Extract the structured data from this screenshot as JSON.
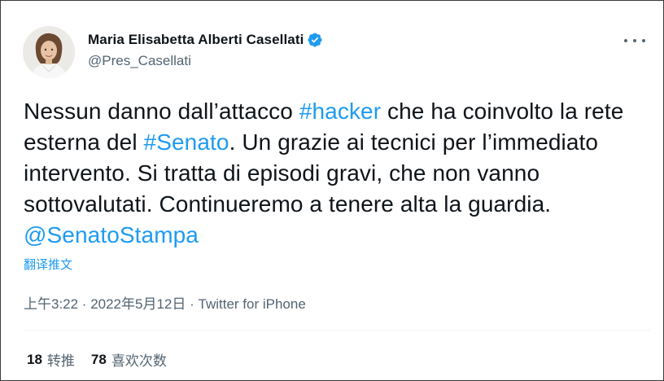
{
  "tweet": {
    "author": {
      "name": "Maria Elisabetta Alberti Casellati",
      "handle": "@Pres_Casellati",
      "verified": true,
      "verified_icon": "verified-badge-icon",
      "avatar_icon": "profile-photo"
    },
    "text": {
      "part1": "Nessun danno dall’attacco ",
      "hashtag1": "#hacker",
      "part2": " che ha coinvolto la rete esterna del ",
      "hashtag2": "#Senato",
      "part3": ". Un grazie ai tecnici per l’immediato intervento. Si tratta di episodi gravi, che non vanno sottovalutati. Continueremo a tenere alta la guardia. ",
      "mention": "@SenatoStampa"
    },
    "translate_label": "翻译推文",
    "timestamp": "上午3:22 · 2022年5月12日",
    "separator": " · ",
    "source": "Twitter for iPhone",
    "stats": {
      "retweets_count": "18",
      "retweets_label": "转推",
      "likes_count": "78",
      "likes_label": "喜欢次数"
    },
    "more_icon": "more-options-icon"
  },
  "colors": {
    "accent": "#1d9bf0",
    "text": "#0f1419",
    "secondary": "#536471",
    "divider": "#eff3f4",
    "border": "#3a3a3a"
  }
}
